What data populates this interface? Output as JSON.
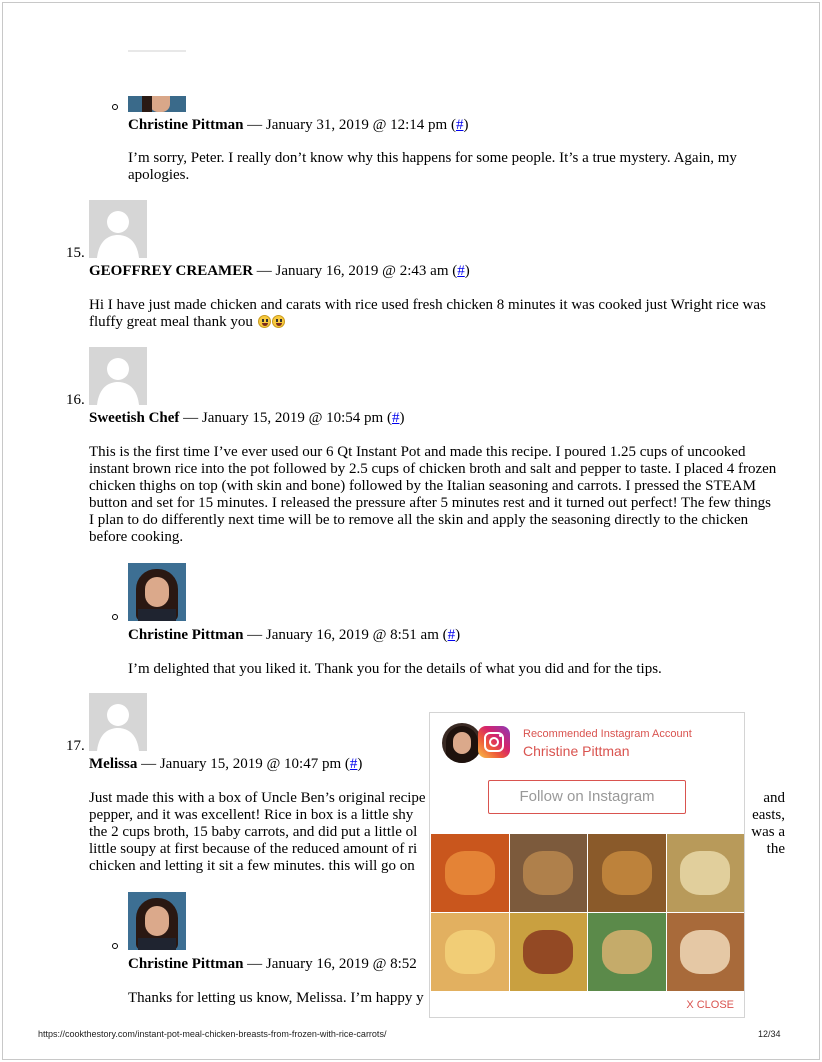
{
  "comments": {
    "c_reply_top": {
      "author": "Christine Pittman",
      "date": " — January 31, 2019 @ 12:14 pm ",
      "hash": "#",
      "body": "I’m sorry, Peter. I really don’t know why this happens for some people. It’s a true mystery. Again, my apologies."
    },
    "c15": {
      "number": "15.",
      "author": "GEOFFREY CREAMER",
      "date": " — January 16, 2019 @ 2:43 am ",
      "hash": "#",
      "body": "Hi I have just made chicken and carats with rice used fresh chicken 8 minutes it was cooked just Wright rice was fluffy great meal thank you"
    },
    "c16": {
      "number": "16.",
      "author": "Sweetish Chef",
      "date": " — January 15, 2019 @ 10:54 pm ",
      "hash": "#",
      "body": "This is the first time I’ve ever used our 6 Qt Instant Pot and made this recipe. I poured 1.25 cups of uncooked instant brown rice into the pot followed by 2.5 cups of chicken broth and salt and pepper to taste. I placed 4 frozen chicken thighs on top (with skin and bone) followed by the Italian seasoning and carrots. I pressed the STEAM button and set for 15 minutes. I released the pressure after 5 minutes rest and it turned out perfect! The few things I plan to do differently next time will be to remove all the skin and apply the seasoning directly to the chicken before cooking."
    },
    "c16_reply": {
      "author": "Christine Pittman",
      "date": " — January 16, 2019 @ 8:51 am ",
      "hash": "#",
      "body": "I’m delighted that you liked it. Thank you for the details of what you did and for the tips."
    },
    "c17": {
      "number": "17.",
      "author": "Melissa",
      "date": " — January 15, 2019 @ 10:47 pm ",
      "hash": "#",
      "body_lines": [
        "Just made this with a box of Uncle Ben’s original recipe",
        "pepper, and it was excellent! Rice in box is a little shy",
        "the 2 cups broth, 15 baby carrots, and did put a little ol",
        "little soupy at first because of the reduced amount of ri",
        "chicken and letting it sit a few minutes. this will go on"
      ],
      "body_right": [
        "and",
        "easts,",
        "was a",
        "the",
        ""
      ]
    },
    "c17_reply": {
      "author": "Christine Pittman",
      "date": " — January 16, 2019 @ 8:52",
      "body": "Thanks for letting us know, Melissa. I’m happy y"
    }
  },
  "instagram": {
    "recommended": "Recommended Instagram Account",
    "name": "Christine Pittman",
    "follow": "Follow on Instagram",
    "close": "X CLOSE",
    "accent": "#d9534f",
    "tiles": [
      {
        "name": "sweet-potato-cubes-photo",
        "bg": "#c9561d",
        "fg": "#e98b3b"
      },
      {
        "name": "ribs-plate-photo",
        "bg": "#7c5a3c",
        "fg": "#b9874e"
      },
      {
        "name": "roast-chicken-photo",
        "bg": "#8a5a2a",
        "fg": "#c58a3e"
      },
      {
        "name": "dip-bowl-photo",
        "bg": "#b89a5a",
        "fg": "#e7d8a8"
      },
      {
        "name": "cheese-sauce-photo",
        "bg": "#e2b060",
        "fg": "#f3d27a"
      },
      {
        "name": "pasta-bowl-photo",
        "bg": "#c9a040",
        "fg": "#8a3a20"
      },
      {
        "name": "casserole-photo",
        "bg": "#5b8a4a",
        "fg": "#d8b070"
      },
      {
        "name": "dessert-squares-photo",
        "bg": "#a86a3a",
        "fg": "#f0d8b8"
      }
    ]
  },
  "footer": {
    "url": "https://cookthestory.com/instant-pot-meal-chicken-breasts-from-frozen-with-rice-carrots/",
    "page": "12/34"
  }
}
